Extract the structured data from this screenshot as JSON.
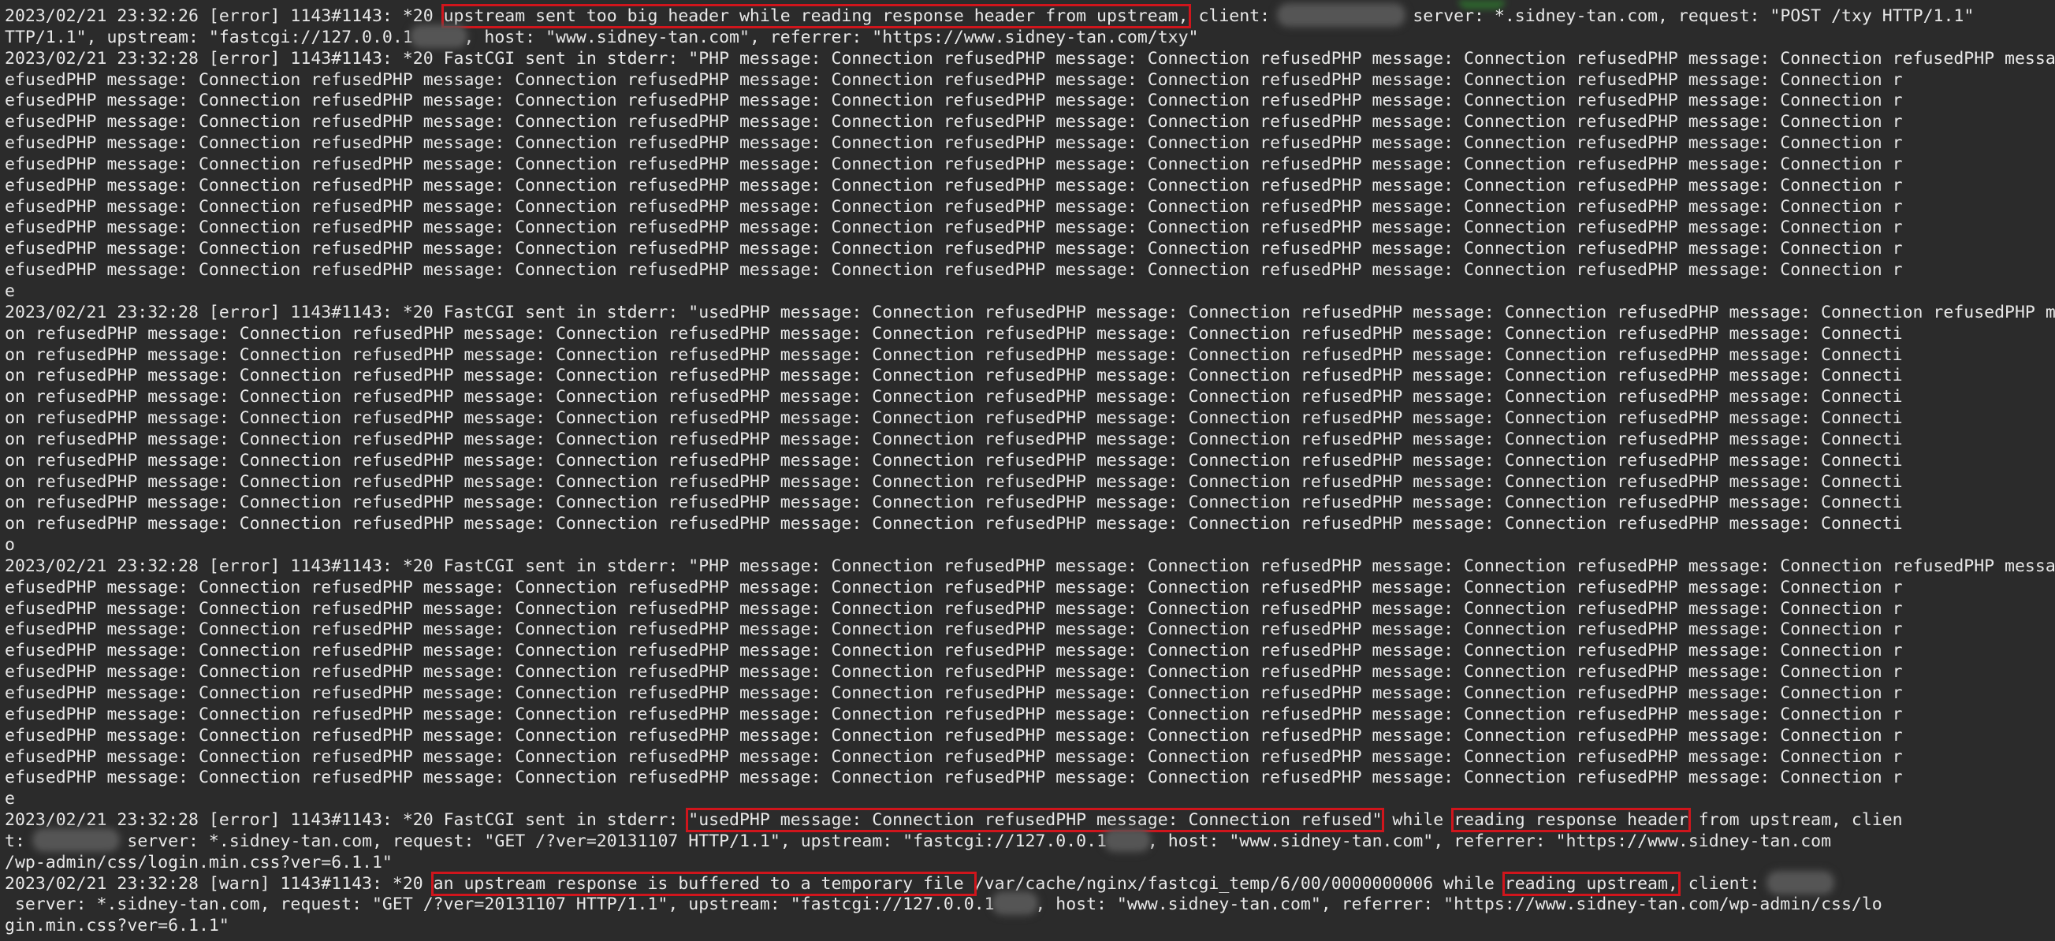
{
  "theme": {
    "background": "#2b2b2b",
    "text": "#e8e8e8",
    "highlight": "#d0151c"
  },
  "log_lines": [
    [
      {
        "t": "2023/02/21 23:32:26 [error] 1143#1143: *20 "
      },
      {
        "t": "upstream sent too big header while reading response header from upstream,",
        "h": true
      },
      {
        "t": " client: "
      },
      {
        "m": 12
      },
      {
        "t": " server: *.sidney-tan.com, request: \"POST /txy HTTP/1.1\""
      }
    ],
    [
      {
        "t": "TTP/1.1\", upstream: \"fastcgi://127.0.0.1"
      },
      {
        "m": 5
      },
      {
        "t": ", host: \"www.sidney-tan.com\", referrer: \"https://www.sidney-tan.com/txy\""
      }
    ],
    [
      {
        "t": "2023/02/21 23:32:28 [error] 1143#1143: *20 FastCGI sent in stderr: \"PHP message: Connection refusedPHP message: Connection refusedPHP message: Connection refusedPHP message: Connection refusedPHP message: Connection r"
      }
    ],
    [
      {
        "t": "efusedPHP message: Connection refusedPHP message: Connection refusedPHP message: Connection refusedPHP message: Connection refusedPHP message: Connection refusedPHP message: Connection r"
      }
    ],
    [
      {
        "t": "efusedPHP message: Connection refusedPHP message: Connection refusedPHP message: Connection refusedPHP message: Connection refusedPHP message: Connection refusedPHP message: Connection r"
      }
    ],
    [
      {
        "t": "efusedPHP message: Connection refusedPHP message: Connection refusedPHP message: Connection refusedPHP message: Connection refusedPHP message: Connection refusedPHP message: Connection r"
      }
    ],
    [
      {
        "t": "efusedPHP message: Connection refusedPHP message: Connection refusedPHP message: Connection refusedPHP message: Connection refusedPHP message: Connection refusedPHP message: Connection r"
      }
    ],
    [
      {
        "t": "efusedPHP message: Connection refusedPHP message: Connection refusedPHP message: Connection refusedPHP message: Connection refusedPHP message: Connection refusedPHP message: Connection r"
      }
    ],
    [
      {
        "t": "efusedPHP message: Connection refusedPHP message: Connection refusedPHP message: Connection refusedPHP message: Connection refusedPHP message: Connection refusedPHP message: Connection r"
      }
    ],
    [
      {
        "t": "efusedPHP message: Connection refusedPHP message: Connection refusedPHP message: Connection refusedPHP message: Connection refusedPHP message: Connection refusedPHP message: Connection r"
      }
    ],
    [
      {
        "t": "efusedPHP message: Connection refusedPHP message: Connection refusedPHP message: Connection refusedPHP message: Connection refusedPHP message: Connection refusedPHP message: Connection r"
      }
    ],
    [
      {
        "t": "efusedPHP message: Connection refusedPHP message: Connection refusedPHP message: Connection refusedPHP message: Connection refusedPHP message: Connection refusedPHP message: Connection r"
      }
    ],
    [
      {
        "t": "efusedPHP message: Connection refusedPHP message: Connection refusedPHP message: Connection refusedPHP message: Connection refusedPHP message: Connection refusedPHP message: Connection r"
      }
    ],
    [
      {
        "t": "e"
      }
    ],
    [
      {
        "t": "2023/02/21 23:32:28 [error] 1143#1143: *20 FastCGI sent in stderr: \"usedPHP message: Connection refusedPHP message: Connection refusedPHP message: Connection refusedPHP message: Connection refusedPHP message: Connecti"
      }
    ],
    [
      {
        "t": "on refusedPHP message: Connection refusedPHP message: Connection refusedPHP message: Connection refusedPHP message: Connection refusedPHP message: Connection refusedPHP message: Connecti"
      }
    ],
    [
      {
        "t": "on refusedPHP message: Connection refusedPHP message: Connection refusedPHP message: Connection refusedPHP message: Connection refusedPHP message: Connection refusedPHP message: Connecti"
      }
    ],
    [
      {
        "t": "on refusedPHP message: Connection refusedPHP message: Connection refusedPHP message: Connection refusedPHP message: Connection refusedPHP message: Connection refusedPHP message: Connecti"
      }
    ],
    [
      {
        "t": "on refusedPHP message: Connection refusedPHP message: Connection refusedPHP message: Connection refusedPHP message: Connection refusedPHP message: Connection refusedPHP message: Connecti"
      }
    ],
    [
      {
        "t": "on refusedPHP message: Connection refusedPHP message: Connection refusedPHP message: Connection refusedPHP message: Connection refusedPHP message: Connection refusedPHP message: Connecti"
      }
    ],
    [
      {
        "t": "on refusedPHP message: Connection refusedPHP message: Connection refusedPHP message: Connection refusedPHP message: Connection refusedPHP message: Connection refusedPHP message: Connecti"
      }
    ],
    [
      {
        "t": "on refusedPHP message: Connection refusedPHP message: Connection refusedPHP message: Connection refusedPHP message: Connection refusedPHP message: Connection refusedPHP message: Connecti"
      }
    ],
    [
      {
        "t": "on refusedPHP message: Connection refusedPHP message: Connection refusedPHP message: Connection refusedPHP message: Connection refusedPHP message: Connection refusedPHP message: Connecti"
      }
    ],
    [
      {
        "t": "on refusedPHP message: Connection refusedPHP message: Connection refusedPHP message: Connection refusedPHP message: Connection refusedPHP message: Connection refusedPHP message: Connecti"
      }
    ],
    [
      {
        "t": "on refusedPHP message: Connection refusedPHP message: Connection refusedPHP message: Connection refusedPHP message: Connection refusedPHP message: Connection refusedPHP message: Connecti"
      }
    ],
    [
      {
        "t": "o"
      }
    ],
    [
      {
        "t": "2023/02/21 23:32:28 [error] 1143#1143: *20 FastCGI sent in stderr: \"PHP message: Connection refusedPHP message: Connection refusedPHP message: Connection refusedPHP message: Connection refusedPHP message: Connection r"
      }
    ],
    [
      {
        "t": "efusedPHP message: Connection refusedPHP message: Connection refusedPHP message: Connection refusedPHP message: Connection refusedPHP message: Connection refusedPHP message: Connection r"
      }
    ],
    [
      {
        "t": "efusedPHP message: Connection refusedPHP message: Connection refusedPHP message: Connection refusedPHP message: Connection refusedPHP message: Connection refusedPHP message: Connection r"
      }
    ],
    [
      {
        "t": "efusedPHP message: Connection refusedPHP message: Connection refusedPHP message: Connection refusedPHP message: Connection refusedPHP message: Connection refusedPHP message: Connection r"
      }
    ],
    [
      {
        "t": "efusedPHP message: Connection refusedPHP message: Connection refusedPHP message: Connection refusedPHP message: Connection refusedPHP message: Connection refusedPHP message: Connection r"
      }
    ],
    [
      {
        "t": "efusedPHP message: Connection refusedPHP message: Connection refusedPHP message: Connection refusedPHP message: Connection refusedPHP message: Connection refusedPHP message: Connection r"
      }
    ],
    [
      {
        "t": "efusedPHP message: Connection refusedPHP message: Connection refusedPHP message: Connection refusedPHP message: Connection refusedPHP message: Connection refusedPHP message: Connection r"
      }
    ],
    [
      {
        "t": "efusedPHP message: Connection refusedPHP message: Connection refusedPHP message: Connection refusedPHP message: Connection refusedPHP message: Connection refusedPHP message: Connection r"
      }
    ],
    [
      {
        "t": "efusedPHP message: Connection refusedPHP message: Connection refusedPHP message: Connection refusedPHP message: Connection refusedPHP message: Connection refusedPHP message: Connection r"
      }
    ],
    [
      {
        "t": "efusedPHP message: Connection refusedPHP message: Connection refusedPHP message: Connection refusedPHP message: Connection refusedPHP message: Connection refusedPHP message: Connection r"
      }
    ],
    [
      {
        "t": "efusedPHP message: Connection refusedPHP message: Connection refusedPHP message: Connection refusedPHP message: Connection refusedPHP message: Connection refusedPHP message: Connection r"
      }
    ],
    [
      {
        "t": "e"
      }
    ],
    [
      {
        "t": "2023/02/21 23:32:28 [error] 1143#1143: *20 FastCGI sent in stderr: "
      },
      {
        "t": "\"usedPHP message: Connection refusedPHP message: Connection refused\"",
        "h": true
      },
      {
        "t": " while "
      },
      {
        "t": "reading response header",
        "h": true
      },
      {
        "t": " from upstream, clien"
      }
    ],
    [
      {
        "t": "t: "
      },
      {
        "m": 8
      },
      {
        "t": " server: *.sidney-tan.com, request: \"GET /?ver=20131107 HTTP/1.1\", upstream: \"fastcgi://127.0.0.1"
      },
      {
        "m": 4
      },
      {
        "t": ", host: \"www.sidney-tan.com\", referrer: \"https://www.sidney-tan.com"
      }
    ],
    [
      {
        "t": "/wp-admin/css/login.min.css?ver=6.1.1\""
      }
    ],
    [
      {
        "t": "2023/02/21 23:32:28 [warn] 1143#1143: *20 "
      },
      {
        "t": "an upstream response is buffered to a temporary file ",
        "h": true
      },
      {
        "t": "/var/cache/nginx/fastcgi_temp/6/00/0000000006 while "
      },
      {
        "t": "reading upstream,",
        "h": true
      },
      {
        "t": " client: "
      },
      {
        "m": 6
      }
    ],
    [
      {
        "t": " server: *.sidney-tan.com, request: \"GET /?ver=20131107 HTTP/1.1\", upstream: \"fastcgi://127.0.0.1"
      },
      {
        "m": 4
      },
      {
        "t": ", host: \"www.sidney-tan.com\", referrer: \"https://www.sidney-tan.com/wp-admin/css/lo"
      }
    ],
    [
      {
        "t": "gin.min.css?ver=6.1.1\""
      }
    ]
  ]
}
